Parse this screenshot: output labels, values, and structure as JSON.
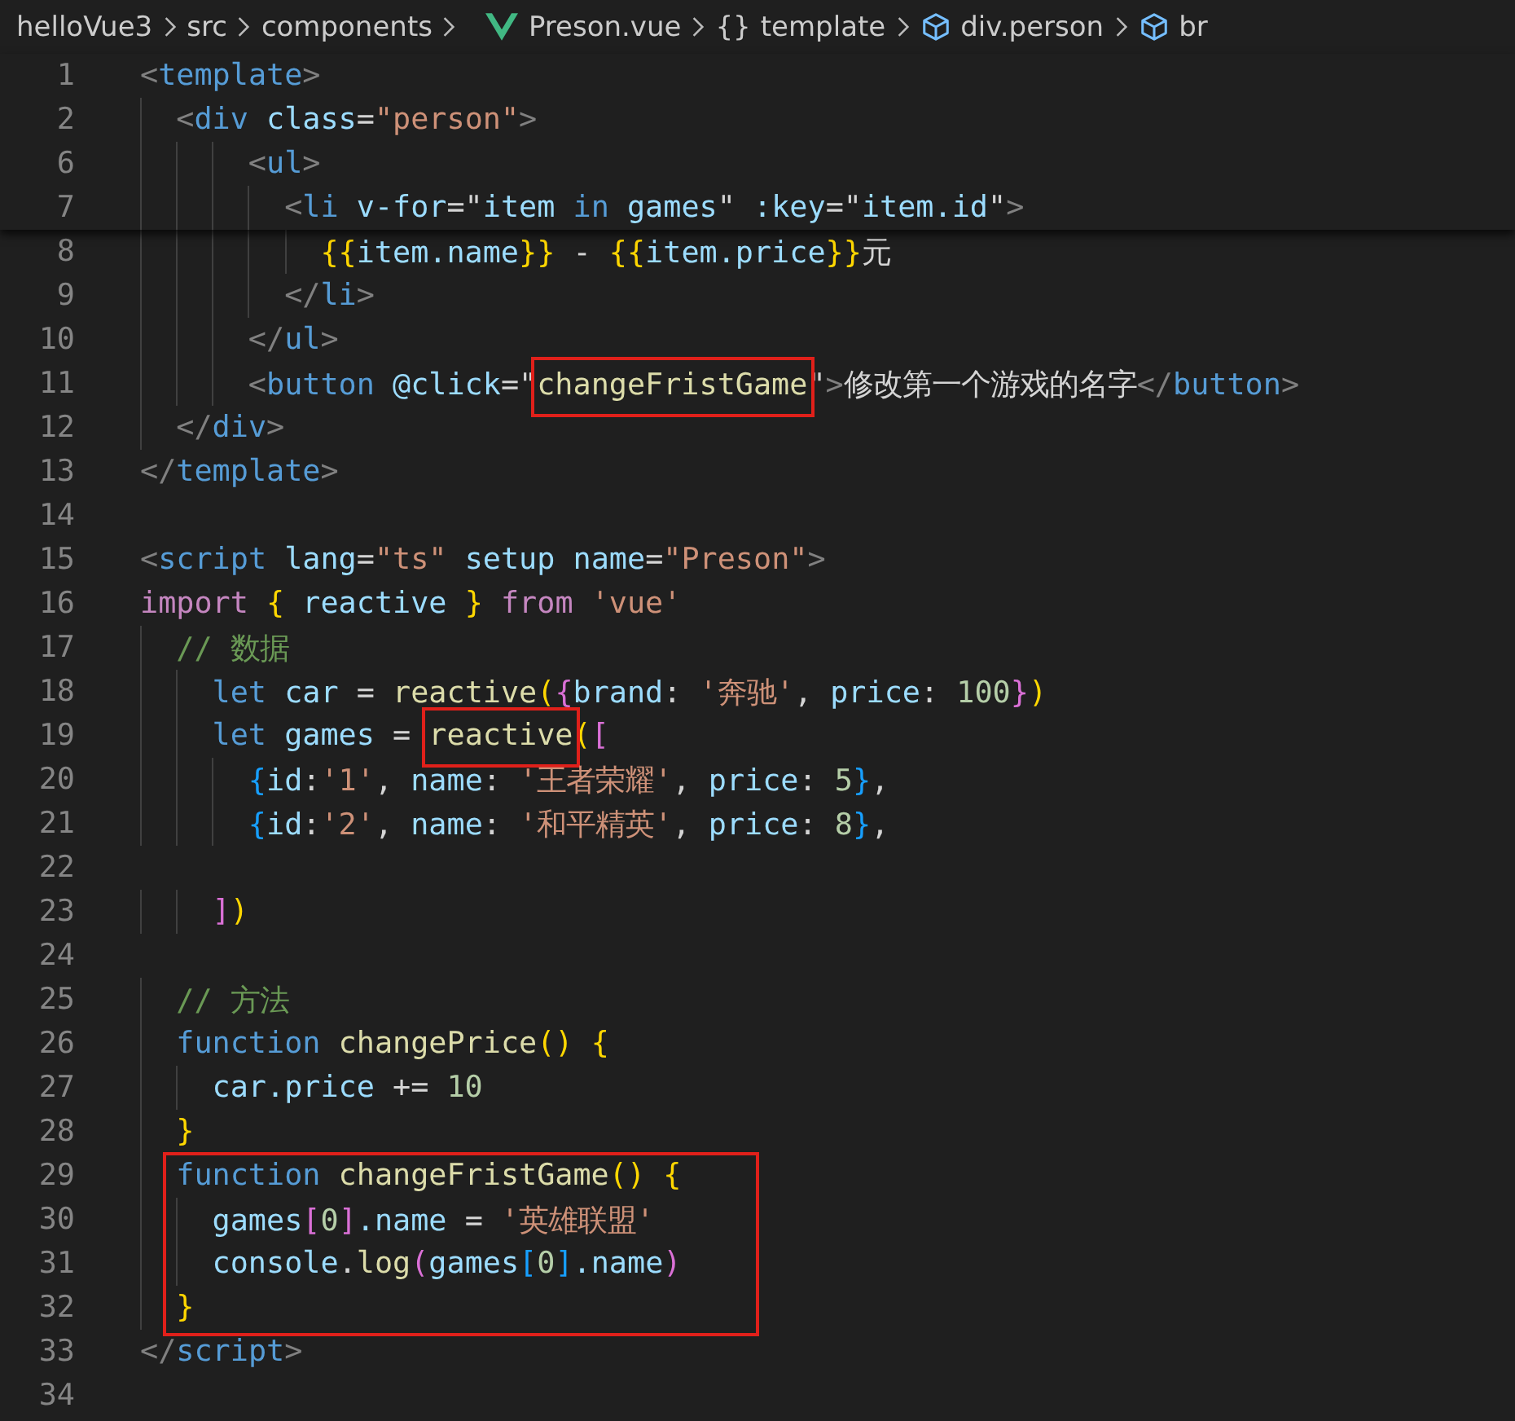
{
  "breadcrumb": [
    {
      "label": "helloVue3",
      "kind": "plain"
    },
    {
      "label": "src",
      "kind": "plain"
    },
    {
      "label": "components",
      "kind": "plain"
    },
    {
      "label": "Preson.vue",
      "kind": "vue"
    },
    {
      "label": "template",
      "kind": "braces",
      "icon_text": "{}"
    },
    {
      "label": "div.person",
      "kind": "cube"
    },
    {
      "label": "br",
      "kind": "cube"
    }
  ],
  "sticky_lines": [
    {
      "n": "1",
      "tokens": [
        {
          "t": "<",
          "kind": "tp"
        },
        {
          "t": "template",
          "kind": "tag"
        },
        {
          "t": ">",
          "kind": "tp"
        }
      ]
    },
    {
      "n": "2",
      "tokens": [
        {
          "t": "  <",
          "kind": "tp"
        },
        {
          "t": "div",
          "kind": "tag"
        },
        {
          "t": " class",
          "kind": "attr"
        },
        {
          "t": "=",
          "kind": "p"
        },
        {
          "t": "\"person\"",
          "kind": "str"
        },
        {
          "t": ">",
          "kind": "tp"
        }
      ]
    },
    {
      "n": "6",
      "tokens": [
        {
          "t": "      <",
          "kind": "tp"
        },
        {
          "t": "ul",
          "kind": "tag"
        },
        {
          "t": ">",
          "kind": "tp"
        }
      ]
    },
    {
      "n": "7",
      "tokens": [
        {
          "t": "        <",
          "kind": "tp"
        },
        {
          "t": "li",
          "kind": "tag"
        },
        {
          "t": " v-for",
          "kind": "attr"
        },
        {
          "t": "=\"",
          "kind": "p"
        },
        {
          "t": "item",
          "kind": "var"
        },
        {
          "t": " in ",
          "kind": "st"
        },
        {
          "t": "games",
          "kind": "var"
        },
        {
          "t": "\"",
          "kind": "p"
        },
        {
          "t": " :key",
          "kind": "attr"
        },
        {
          "t": "=\"",
          "kind": "p"
        },
        {
          "t": "item.id",
          "kind": "var"
        },
        {
          "t": "\"",
          "kind": "p"
        },
        {
          "t": ">",
          "kind": "tp"
        }
      ]
    }
  ],
  "code_blocks": [
    {
      "boxed": false,
      "lines": [
        {
          "n": "8",
          "tokens": [
            {
              "t": "          {{",
              "kind": "b1"
            },
            {
              "t": "item.name",
              "kind": "var"
            },
            {
              "t": "}}",
              "kind": "b1"
            },
            {
              "t": " - ",
              "kind": "p"
            },
            {
              "t": "{{",
              "kind": "b1"
            },
            {
              "t": "item.price",
              "kind": "var"
            },
            {
              "t": "}}",
              "kind": "b1"
            },
            {
              "t": "元",
              "kind": "p"
            }
          ]
        },
        {
          "n": "9",
          "tokens": [
            {
              "t": "        </",
              "kind": "tp"
            },
            {
              "t": "li",
              "kind": "tag"
            },
            {
              "t": ">",
              "kind": "tp"
            }
          ]
        },
        {
          "n": "10",
          "tokens": [
            {
              "t": "      </",
              "kind": "tp"
            },
            {
              "t": "ul",
              "kind": "tag"
            },
            {
              "t": ">",
              "kind": "tp"
            }
          ]
        },
        {
          "n": "11",
          "tokens": [
            {
              "t": "      <",
              "kind": "tp"
            },
            {
              "t": "button",
              "kind": "tag"
            },
            {
              "t": " @click",
              "kind": "attr"
            },
            {
              "t": "=\"",
              "kind": "p"
            },
            {
              "t": "changeFristGame",
              "kind": "fn",
              "boxed": true
            },
            {
              "t": "\"",
              "kind": "p"
            },
            {
              "t": ">",
              "kind": "tp"
            },
            {
              "t": "修改第一个游戏的名字",
              "kind": "p"
            },
            {
              "t": "</",
              "kind": "tp"
            },
            {
              "t": "button",
              "kind": "tag"
            },
            {
              "t": ">",
              "kind": "tp"
            }
          ]
        },
        {
          "n": "12",
          "tokens": [
            {
              "t": "  </",
              "kind": "tp"
            },
            {
              "t": "div",
              "kind": "tag"
            },
            {
              "t": ">",
              "kind": "tp"
            }
          ]
        },
        {
          "n": "13",
          "tokens": [
            {
              "t": "</",
              "kind": "tp"
            },
            {
              "t": "template",
              "kind": "tag"
            },
            {
              "t": ">",
              "kind": "tp"
            }
          ]
        },
        {
          "n": "14"
        },
        {
          "n": "15",
          "tokens": [
            {
              "t": "<",
              "kind": "tp"
            },
            {
              "t": "script",
              "kind": "tag"
            },
            {
              "t": " lang",
              "kind": "attr"
            },
            {
              "t": "=",
              "kind": "p"
            },
            {
              "t": "\"ts\"",
              "kind": "str"
            },
            {
              "t": " setup name",
              "kind": "attr"
            },
            {
              "t": "=",
              "kind": "p"
            },
            {
              "t": "\"Preson\"",
              "kind": "str"
            },
            {
              "t": ">",
              "kind": "tp"
            }
          ]
        },
        {
          "n": "16",
          "tokens": [
            {
              "t": "import ",
              "kind": "kw"
            },
            {
              "t": "{",
              "kind": "b1"
            },
            {
              "t": " reactive ",
              "kind": "var"
            },
            {
              "t": "}",
              "kind": "b1"
            },
            {
              "t": " from ",
              "kind": "kw"
            },
            {
              "t": "'vue'",
              "kind": "str"
            }
          ]
        },
        {
          "n": "17",
          "tokens": [
            {
              "t": "  // 数据",
              "kind": "cm"
            }
          ]
        },
        {
          "n": "18",
          "tokens": [
            {
              "t": "    let",
              "kind": "st"
            },
            {
              "t": " car ",
              "kind": "var"
            },
            {
              "t": "= ",
              "kind": "p"
            },
            {
              "t": "reactive",
              "kind": "fn"
            },
            {
              "t": "(",
              "kind": "b1"
            },
            {
              "t": "{",
              "kind": "b2"
            },
            {
              "t": "brand",
              "kind": "var"
            },
            {
              "t": ": ",
              "kind": "p"
            },
            {
              "t": "'奔驰'",
              "kind": "str"
            },
            {
              "t": ", ",
              "kind": "p"
            },
            {
              "t": "price",
              "kind": "var"
            },
            {
              "t": ": ",
              "kind": "p"
            },
            {
              "t": "100",
              "kind": "num"
            },
            {
              "t": "}",
              "kind": "b2"
            },
            {
              "t": ")",
              "kind": "b1"
            }
          ]
        },
        {
          "n": "19",
          "tokens": [
            {
              "t": "    let",
              "kind": "st"
            },
            {
              "t": " games ",
              "kind": "var"
            },
            {
              "t": "= ",
              "kind": "p"
            },
            {
              "t": "reactive",
              "kind": "fn",
              "boxed": true
            },
            {
              "t": "(",
              "kind": "b1"
            },
            {
              "t": "[",
              "kind": "b2"
            }
          ]
        },
        {
          "n": "20",
          "tokens": [
            {
              "t": "      {",
              "kind": "b3"
            },
            {
              "t": "id",
              "kind": "var"
            },
            {
              "t": ":",
              "kind": "p"
            },
            {
              "t": "'1'",
              "kind": "str"
            },
            {
              "t": ", ",
              "kind": "p"
            },
            {
              "t": "name",
              "kind": "var"
            },
            {
              "t": ": ",
              "kind": "p"
            },
            {
              "t": "'王者荣耀'",
              "kind": "str"
            },
            {
              "t": ", ",
              "kind": "p"
            },
            {
              "t": "price",
              "kind": "var"
            },
            {
              "t": ": ",
              "kind": "p"
            },
            {
              "t": "5",
              "kind": "num"
            },
            {
              "t": "}",
              "kind": "b3"
            },
            {
              "t": ",",
              "kind": "p"
            }
          ]
        },
        {
          "n": "21",
          "tokens": [
            {
              "t": "      {",
              "kind": "b3"
            },
            {
              "t": "id",
              "kind": "var"
            },
            {
              "t": ":",
              "kind": "p"
            },
            {
              "t": "'2'",
              "kind": "str"
            },
            {
              "t": ", ",
              "kind": "p"
            },
            {
              "t": "name",
              "kind": "var"
            },
            {
              "t": ": ",
              "kind": "p"
            },
            {
              "t": "'和平精英'",
              "kind": "str"
            },
            {
              "t": ", ",
              "kind": "p"
            },
            {
              "t": "price",
              "kind": "var"
            },
            {
              "t": ": ",
              "kind": "p"
            },
            {
              "t": "8",
              "kind": "num"
            },
            {
              "t": "}",
              "kind": "b3"
            },
            {
              "t": ",",
              "kind": "p"
            }
          ]
        },
        {
          "n": "22"
        },
        {
          "n": "23",
          "tokens": [
            {
              "t": "    ]",
              "kind": "b2"
            },
            {
              "t": ")",
              "kind": "b1"
            }
          ]
        },
        {
          "n": "24"
        },
        {
          "n": "25",
          "tokens": [
            {
              "t": "  // 方法",
              "kind": "cm"
            }
          ]
        },
        {
          "n": "26",
          "tokens": [
            {
              "t": "  function ",
              "kind": "st"
            },
            {
              "t": "changePrice",
              "kind": "fn"
            },
            {
              "t": "()",
              "kind": "b1"
            },
            {
              "t": " {",
              "kind": "b1"
            }
          ]
        },
        {
          "n": "27",
          "tokens": [
            {
              "t": "    car.price",
              "kind": "var"
            },
            {
              "t": " += ",
              "kind": "p"
            },
            {
              "t": "10",
              "kind": "num"
            }
          ]
        },
        {
          "n": "28",
          "tokens": [
            {
              "t": "  }",
              "kind": "b1"
            }
          ]
        }
      ]
    },
    {
      "boxed": true,
      "lines": [
        {
          "n": "29",
          "tokens": [
            {
              "t": "  function ",
              "kind": "st"
            },
            {
              "t": "changeFristGame",
              "kind": "fn"
            },
            {
              "t": "()",
              "kind": "b1"
            },
            {
              "t": " {",
              "kind": "b1"
            }
          ]
        },
        {
          "n": "30",
          "tokens": [
            {
              "t": "    games",
              "kind": "var"
            },
            {
              "t": "[",
              "kind": "b2"
            },
            {
              "t": "0",
              "kind": "num"
            },
            {
              "t": "]",
              "kind": "b2"
            },
            {
              "t": ".name",
              "kind": "var"
            },
            {
              "t": " = ",
              "kind": "p"
            },
            {
              "t": "'英雄联盟'",
              "kind": "str"
            }
          ]
        },
        {
          "n": "31",
          "tokens": [
            {
              "t": "    console",
              "kind": "var"
            },
            {
              "t": ".",
              "kind": "p"
            },
            {
              "t": "log",
              "kind": "fn"
            },
            {
              "t": "(",
              "kind": "b2"
            },
            {
              "t": "games",
              "kind": "var"
            },
            {
              "t": "[",
              "kind": "b3"
            },
            {
              "t": "0",
              "kind": "num"
            },
            {
              "t": "]",
              "kind": "b3"
            },
            {
              "t": ".name",
              "kind": "var"
            },
            {
              "t": ")",
              "kind": "b2"
            }
          ]
        },
        {
          "n": "32",
          "tokens": [
            {
              "t": "  }",
              "kind": "b1"
            }
          ]
        }
      ]
    },
    {
      "boxed": false,
      "lines": [
        {
          "n": "33",
          "tokens": [
            {
              "t": "</",
              "kind": "tp"
            },
            {
              "t": "script",
              "kind": "tag"
            },
            {
              "t": ">",
              "kind": "tp"
            }
          ]
        },
        {
          "n": "34"
        }
      ]
    }
  ]
}
